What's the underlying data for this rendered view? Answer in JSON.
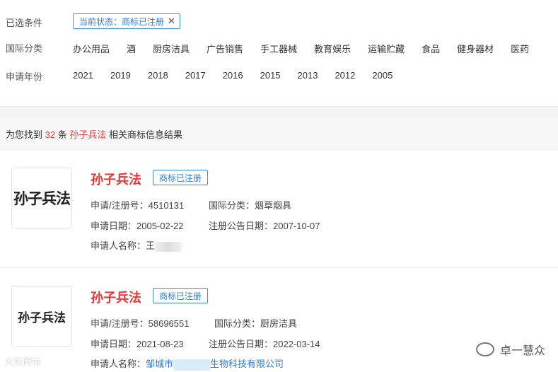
{
  "filters": {
    "selected_label": "已选条件",
    "selected_chip": "当前状态：商标已注册",
    "class_label": "国际分类",
    "classes": [
      "办公用品",
      "酒",
      "厨房洁具",
      "广告销售",
      "手工器械",
      "教育娱乐",
      "运输贮藏",
      "食品",
      "健身器材",
      "医药"
    ],
    "year_label": "申请年份",
    "years": [
      "2021",
      "2019",
      "2018",
      "2017",
      "2016",
      "2015",
      "2013",
      "2012",
      "2005"
    ]
  },
  "result_bar": {
    "prefix": "为您找到",
    "count": "32",
    "unit": "条",
    "keyword": "孙子兵法",
    "suffix": "相关商标信息结果"
  },
  "results": [
    {
      "logo_text": "孙子兵法",
      "name": "孙子兵法",
      "status": "商标已注册",
      "reg_no_label": "申请/注册号：",
      "reg_no": "4510131",
      "class_label": "国际分类：",
      "class": "烟草烟具",
      "apply_date_label": "申请日期：",
      "apply_date": "2005-02-22",
      "announce_label": "注册公告日期：",
      "announce_date": "2007-10-07",
      "applicant_label": "申请人名称：",
      "applicant": "王"
    },
    {
      "logo_text": "孙子兵法",
      "name": "孙子兵法",
      "status": "商标已注册",
      "reg_no_label": "申请/注册号：",
      "reg_no": "58696551",
      "class_label": "国际分类：",
      "class": "厨房洁具",
      "apply_date_label": "申请日期：",
      "apply_date": "2021-08-23",
      "announce_label": "注册公告日期：",
      "announce_date": "2022-03-14",
      "applicant_label": "申请人名称：",
      "applicant_a": "邹城市",
      "applicant_b": "生物科技有限公司"
    }
  ],
  "watermark": "卓一慧众",
  "watermark2": "大数跨境"
}
